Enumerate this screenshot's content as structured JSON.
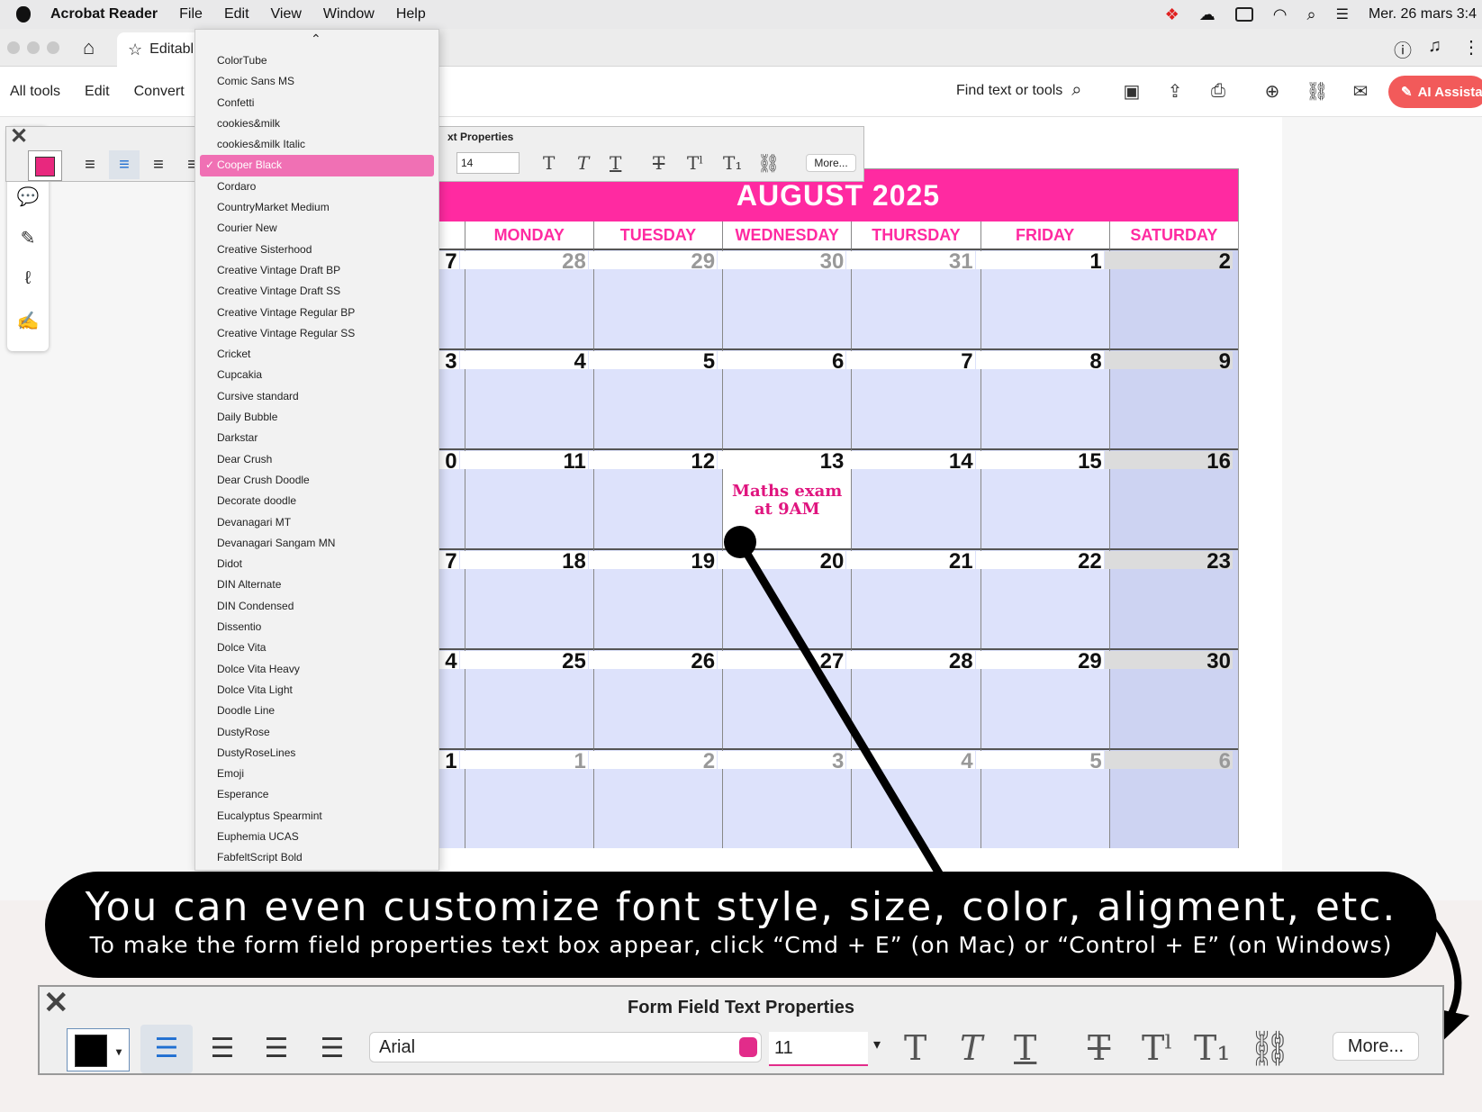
{
  "menubar": {
    "app": "Acrobat Reader",
    "items": [
      "File",
      "Edit",
      "View",
      "Window",
      "Help"
    ],
    "datetime": "Mer. 26 mars  3:4"
  },
  "tab": {
    "label": "Editabl"
  },
  "toolbar": {
    "items": [
      "All tools",
      "Edit",
      "Convert"
    ],
    "find": "Find text or tools",
    "ai_label": "AI Assista"
  },
  "small_panel": {
    "title": "xt Properties",
    "size": "14",
    "more": "More..."
  },
  "font_menu": {
    "selected": "Cooper Black",
    "fonts": [
      "ColorTube",
      "Comic Sans MS",
      "Confetti",
      "cookies&milk",
      "cookies&milk Italic",
      "Cooper Black",
      "Cordaro",
      "CountryMarket Medium",
      "Courier New",
      "Creative Sisterhood",
      "Creative Vintage Draft BP",
      "Creative Vintage Draft SS",
      "Creative Vintage Regular BP",
      "Creative Vintage Regular SS",
      "Cricket",
      "Cupcakia",
      "Cursive standard",
      "Daily Bubble",
      "Darkstar",
      "Dear Crush",
      "Dear Crush Doodle",
      "Decorate doodle",
      "Devanagari MT",
      "Devanagari Sangam MN",
      "Didot",
      "DIN Alternate",
      "DIN Condensed",
      "Dissentio",
      "Dolce Vita",
      "Dolce Vita Heavy",
      "Dolce Vita Light",
      "Doodle Line",
      "DustyRose",
      "DustyRoseLines",
      "Emoji",
      "Esperance",
      "Eucalyptus Spearmint",
      "Euphemia UCAS",
      "FabfeltScript Bold"
    ]
  },
  "calendar": {
    "title": "AUGUST 2025",
    "days": [
      "MONDAY",
      "TUESDAY",
      "WEDNESDAY",
      "THURSDAY",
      "FRIDAY",
      "SATURDAY"
    ],
    "stubs": [
      "7",
      "3",
      "0",
      "7",
      "4",
      "1"
    ],
    "weeks": [
      [
        {
          "n": "28",
          "grey": true
        },
        {
          "n": "29",
          "grey": true
        },
        {
          "n": "30",
          "grey": true
        },
        {
          "n": "31",
          "grey": true
        },
        {
          "n": "1"
        },
        {
          "n": "2"
        }
      ],
      [
        {
          "n": "4"
        },
        {
          "n": "5"
        },
        {
          "n": "6"
        },
        {
          "n": "7"
        },
        {
          "n": "8"
        },
        {
          "n": "9"
        }
      ],
      [
        {
          "n": "11"
        },
        {
          "n": "12"
        },
        {
          "n": "13",
          "note": "Maths exam\nat 9AM"
        },
        {
          "n": "14"
        },
        {
          "n": "15"
        },
        {
          "n": "16"
        }
      ],
      [
        {
          "n": "18"
        },
        {
          "n": "19"
        },
        {
          "n": "20"
        },
        {
          "n": "21"
        },
        {
          "n": "22"
        },
        {
          "n": "23"
        }
      ],
      [
        {
          "n": "25"
        },
        {
          "n": "26"
        },
        {
          "n": "27"
        },
        {
          "n": "28"
        },
        {
          "n": "29"
        },
        {
          "n": "30"
        }
      ],
      [
        {
          "n": "1",
          "grey": true
        },
        {
          "n": "2",
          "grey": true
        },
        {
          "n": "3",
          "grey": true
        },
        {
          "n": "4",
          "grey": true
        },
        {
          "n": "5",
          "grey": true
        },
        {
          "n": "6",
          "grey": true
        }
      ]
    ],
    "accent": "#ff2aa1"
  },
  "banner": {
    "headline": "You can even customize font style, size, color, aligment, etc.",
    "sub": "To make the form field properties text box appear, click “Cmd + E” (on Mac) or “Control + E” (on Windows)"
  },
  "big_panel": {
    "title": "Form Field Text Properties",
    "font": "Arial",
    "size": "11",
    "more": "More..."
  },
  "icons": [
    "apple-icon",
    "home-icon",
    "star-icon",
    "search-icon",
    "save-icon",
    "upload-icon",
    "print-icon",
    "share-icon",
    "link-icon",
    "mail-icon",
    "close-icon",
    "comment-icon",
    "pen-icon",
    "lasso-icon",
    "sign-icon"
  ]
}
